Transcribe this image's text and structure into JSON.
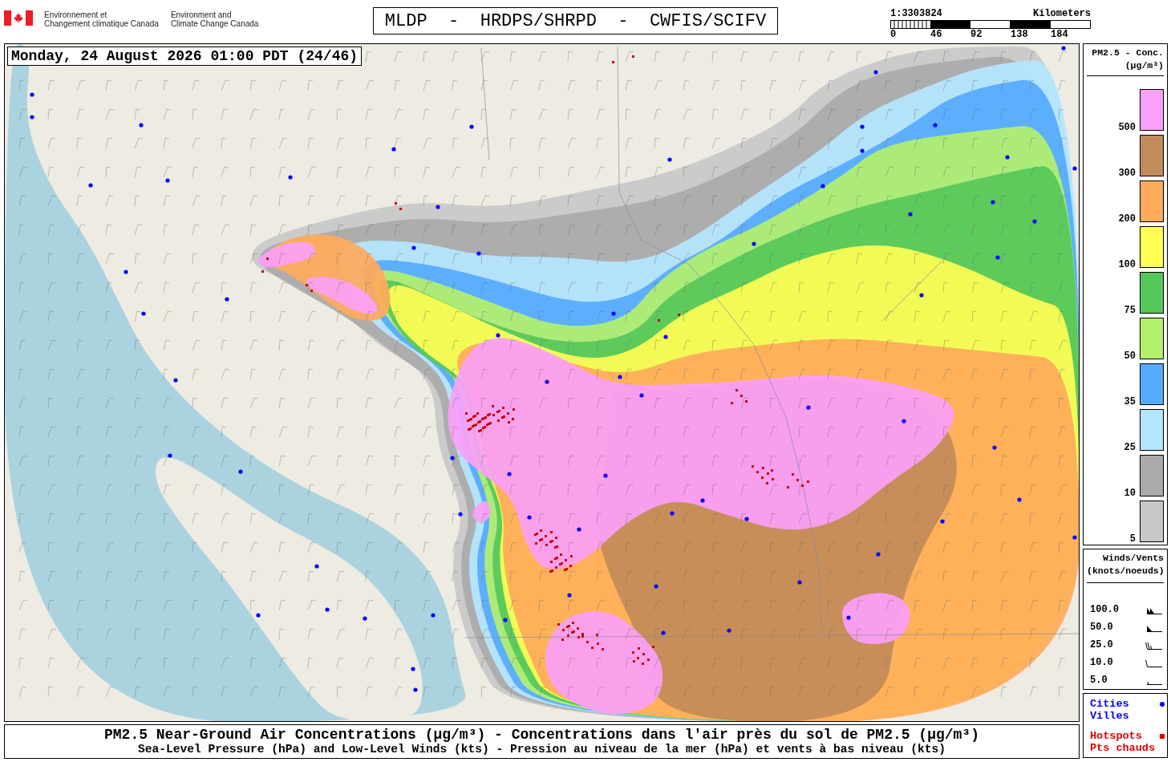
{
  "header": {
    "agency_fr": [
      "Environnement et",
      "Changement climatique Canada"
    ],
    "agency_en": [
      "Environment and",
      "Climate Change Canada"
    ],
    "title": "MLDP  -  HRDPS/SHRPD  -  CWFIS/SCIFV",
    "scale": {
      "ratio": "1:3303824",
      "unit": "Kilometers",
      "ticks": [
        "0",
        "46",
        "92",
        "138",
        "184"
      ]
    }
  },
  "map": {
    "timestamp": "Monday, 24 August 2026 01:00 PDT (24/46)"
  },
  "caption": {
    "title": "PM2.5 Near-Ground Air Concentrations (µg/m³) - Concentrations dans l'air près du sol de PM2.5 (µg/m³)",
    "subtitle": "Sea-Level Pressure (hPa) and Low-Level Winds (kts) - Pression au niveau de la mer (hPa) et vents à bas niveau (kts)"
  },
  "concentration_legend": {
    "title": "PM2.5 - Conc.",
    "unit": "(µg/m³)",
    "items": [
      {
        "label": "500",
        "color": "#fba0f8"
      },
      {
        "label": "300",
        "color": "#c28b5a"
      },
      {
        "label": "200",
        "color": "#ffaa5a"
      },
      {
        "label": "100",
        "color": "#ffff55"
      },
      {
        "label": "75",
        "color": "#55c85a"
      },
      {
        "label": "50",
        "color": "#b4f06e"
      },
      {
        "label": "35",
        "color": "#55aaff"
      },
      {
        "label": "25",
        "color": "#b4e6ff"
      },
      {
        "label": "10",
        "color": "#aaaaaa"
      },
      {
        "label": "5",
        "color": "#c8c8c8"
      }
    ]
  },
  "wind_legend": {
    "title": "Winds/Vents",
    "unit": "(knots/noeuds)",
    "items": [
      {
        "label": "100.0",
        "kind": "twopennants"
      },
      {
        "label": "50.0",
        "kind": "pennant"
      },
      {
        "label": "25.0",
        "kind": "barbs"
      },
      {
        "label": "10.0",
        "kind": "barb"
      },
      {
        "label": "5.0",
        "kind": "halfbarb"
      }
    ]
  },
  "marker_legend": {
    "items": [
      {
        "lines": [
          "Cities",
          "Villes"
        ],
        "color": "#0000ff",
        "kind": "dot"
      },
      {
        "lines": [
          "Hotspots",
          "Pts chauds"
        ],
        "color": "#dd0000",
        "kind": "square"
      }
    ]
  }
}
